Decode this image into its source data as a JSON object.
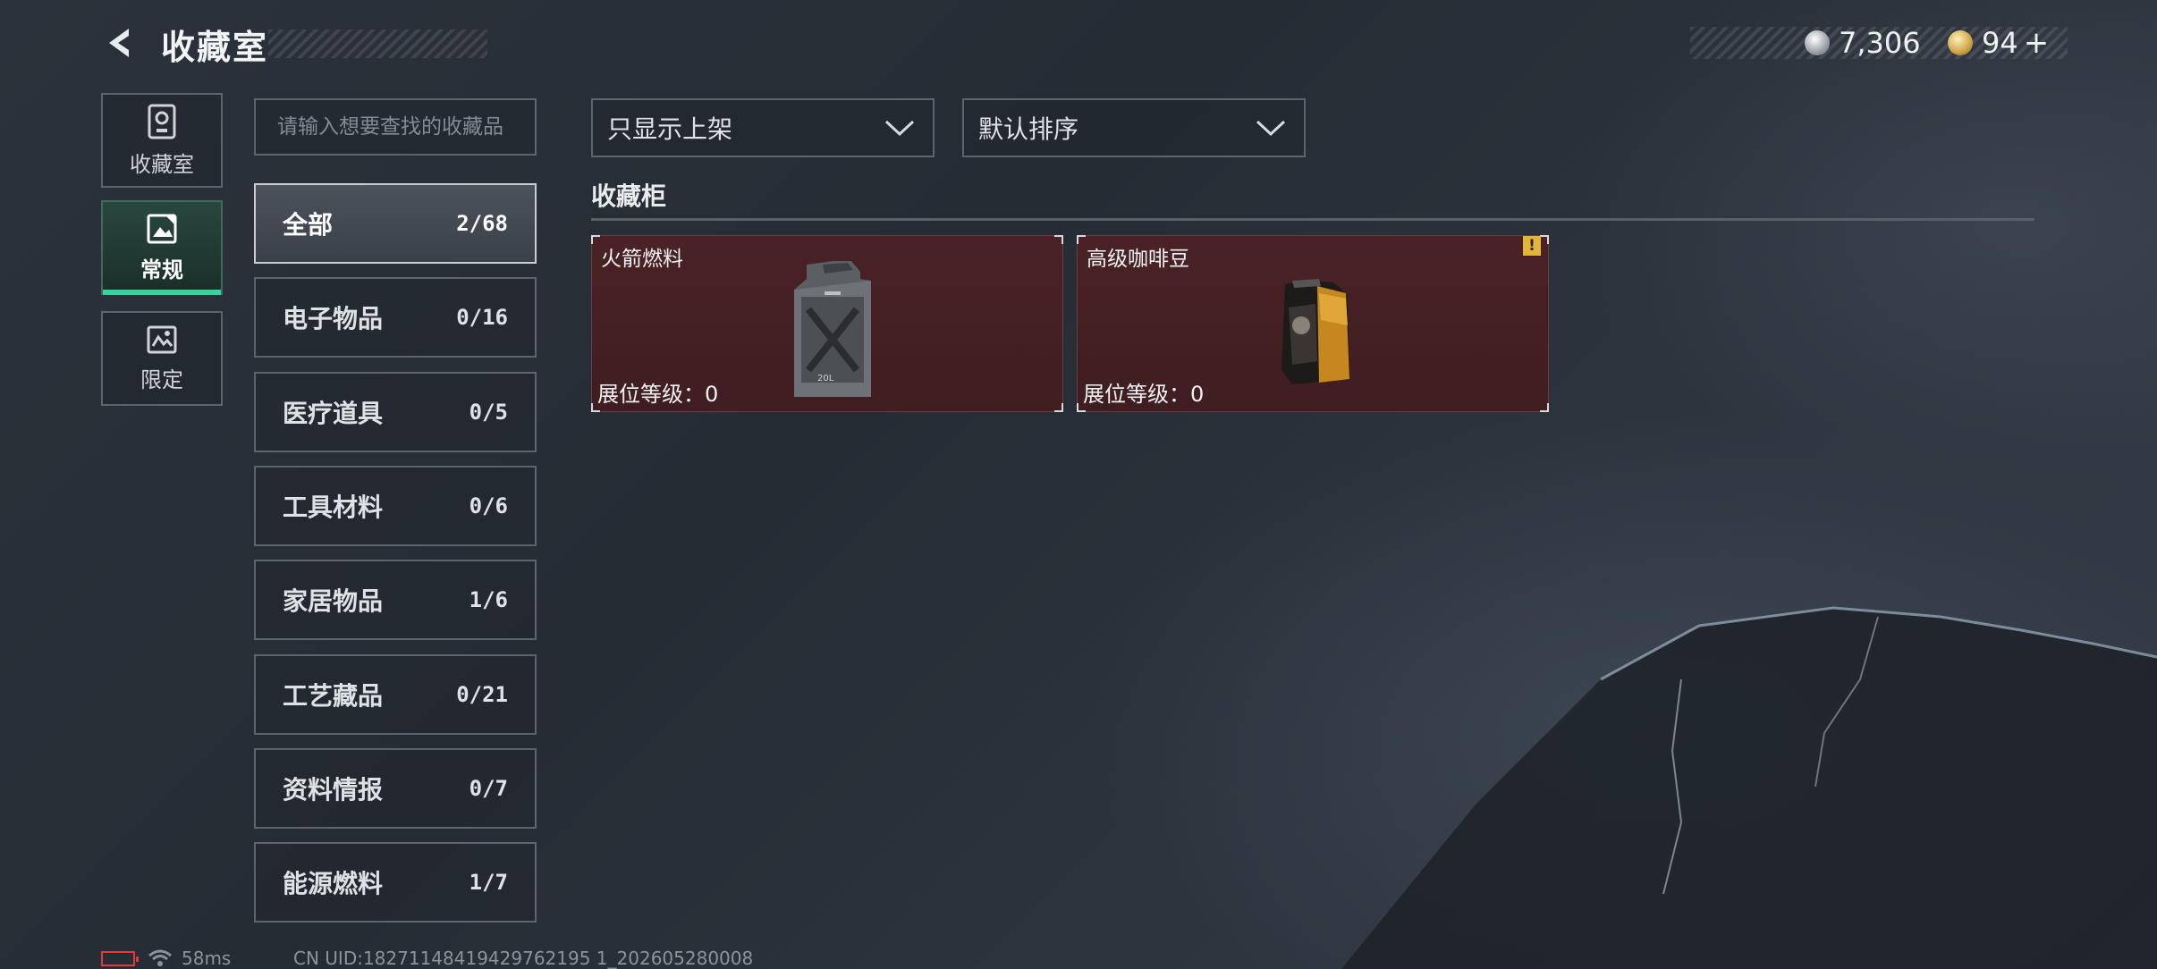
{
  "header": {
    "title": "收藏室",
    "currency_silver": "7,306",
    "currency_gold": "94",
    "gold_plus": "+"
  },
  "side_nav": [
    {
      "label": "收藏室",
      "icon": "trophy-icon"
    },
    {
      "label": "常规",
      "icon": "image-card-icon",
      "active": true
    },
    {
      "label": "限定",
      "icon": "limited-picture-icon"
    }
  ],
  "search": {
    "placeholder": "请输入想要查找的收藏品",
    "value": ""
  },
  "categories": [
    {
      "name": "全部",
      "count": "2/68",
      "active": true
    },
    {
      "name": "电子物品",
      "count": "0/16"
    },
    {
      "name": "医疗道具",
      "count": "0/5"
    },
    {
      "name": "工具材料",
      "count": "0/6"
    },
    {
      "name": "家居物品",
      "count": "1/6"
    },
    {
      "name": "工艺藏品",
      "count": "0/21"
    },
    {
      "name": "资料情报",
      "count": "0/7"
    },
    {
      "name": "能源燃料",
      "count": "1/7"
    }
  ],
  "filters": {
    "show_filter": "只显示上架",
    "sort": "默认排序"
  },
  "section": {
    "title": "收藏柜"
  },
  "cards": [
    {
      "name": "火箭燃料",
      "level": "展位等级：0",
      "image": "fuel-jerrycan",
      "warning": false
    },
    {
      "name": "高级咖啡豆",
      "level": "展位等级：0",
      "image": "coffee-bean-bag",
      "warning": true,
      "warning_text": "!"
    }
  ],
  "status": {
    "ping": "58ms",
    "uid": "CN UID:18271148419429762195 1_202605280008"
  },
  "colors": {
    "accent_green": "#36d39a",
    "card_bg": "#4a2226",
    "battery_red": "#e23b3b",
    "warning_yellow": "#e5b53a"
  }
}
